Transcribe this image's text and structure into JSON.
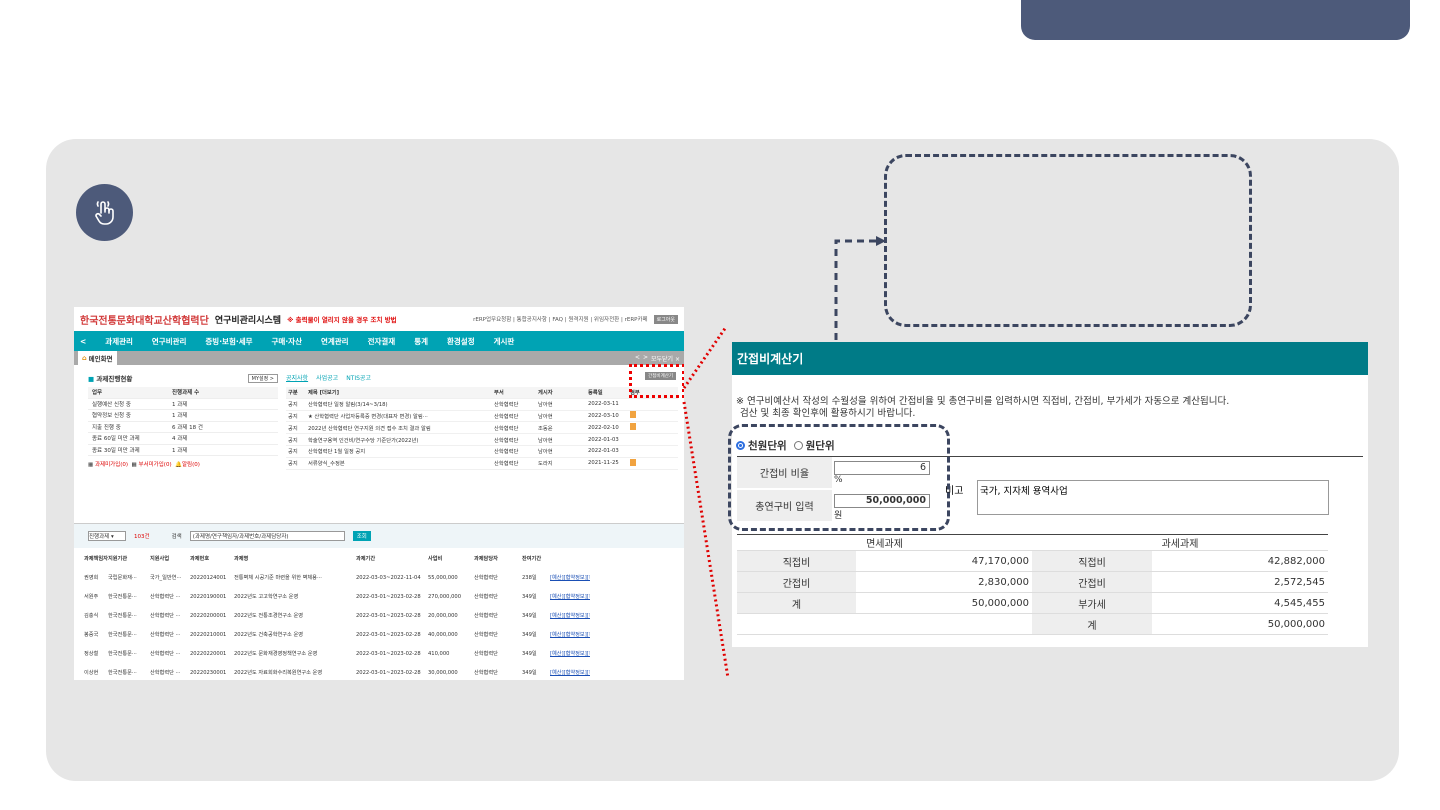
{
  "erp": {
    "logo": "한국전통문화대학교산학협력단",
    "system_name": "연구비관리시스템",
    "notice": "※ 출력물이 열리지 않을 경우 조치 방법",
    "top_links": "rERP업무요청함 | 통합공지사항 | FAQ | 원격지원 | 위임자전환 | rERP카페",
    "logout": "로그아웃",
    "nav": [
      "과제관리",
      "연구비관리",
      "증빙·보험·세무",
      "구매·자산",
      "연계관리",
      "전자결재",
      "통계",
      "환경설정",
      "게시판"
    ],
    "home_tab": "메인화면",
    "tab_ctrl": [
      "<",
      ">",
      "모두닫기 ×"
    ],
    "status": {
      "title": "과제진행현황",
      "my_button": "MY설정 >",
      "headers": [
        "업무",
        "진행과제 수"
      ],
      "rows": [
        [
          "실행예산 신청 중",
          "1 과제"
        ],
        [
          "협약정보 신청 중",
          "1 과제"
        ],
        [
          "지출 진행 중",
          "6 과제 18 건"
        ],
        [
          "종료 60일 미만 과제",
          "4 과제"
        ],
        [
          "종료 30일 미만 과제",
          "1 과제"
        ]
      ],
      "footer": [
        "과제미가입(0)",
        "부서미가입(0)",
        "알림(0)"
      ]
    },
    "notices": {
      "tabs": [
        "공지사항",
        "사업공고",
        "NTIS공고"
      ],
      "calc_button": "간접비계산기",
      "headers": [
        "구분",
        "제목 [더보기]",
        "부서",
        "게시자",
        "등록일",
        "첨부"
      ],
      "rows": [
        [
          "공지",
          "산학협력단 일정 알림(3/14~3/18)",
          "산학협력단",
          "남아현",
          "2022-03-11",
          ""
        ],
        [
          "공지",
          "★ 산학협력단 사업자등록증 변경(대표자 변경) 알림···",
          "산학협력단",
          "남아현",
          "2022-03-10",
          "file"
        ],
        [
          "공지",
          "2022년 산학협력단 연구지원 의견 접수 조치 결과 알림",
          "산학협력단",
          "조동윤",
          "2022-02-10",
          "file"
        ],
        [
          "공지",
          "학술연구용역 인건비/연구수당 기준단가(2022년)",
          "산학협력단",
          "남아현",
          "2022-01-03",
          ""
        ],
        [
          "공지",
          "산학협력단 1월 일정 공지",
          "산학협력단",
          "남아현",
          "2022-01-03",
          ""
        ],
        [
          "공지",
          "서류양식_수정본",
          "산학협력단",
          "도라지",
          "2021-11-25",
          "file"
        ]
      ]
    },
    "list": {
      "select": "진행과제",
      "count": "103건",
      "search_label": "검색",
      "search_placeholder": "(과제명/연구책임자/과제번호/과제담당자)",
      "search_button": "조회",
      "headers": [
        "과제책임자",
        "지원기관",
        "지원사업",
        "과제번호",
        "과제명",
        "과제기간",
        "사업비",
        "과제담당자",
        "잔여기간",
        ""
      ],
      "rows": [
        [
          "권영희",
          "국립문화재···",
          "국가_일반연···",
          "20220124001",
          "전통벽체 시공기준 마련을 위한 벽체용···",
          "2022-03-03~2022-11-04",
          "55,000,000",
          "산학협력단",
          "238일",
          "[예산][협약정보][청구][기금]"
        ],
        [
          "서원주",
          "한국전통문···",
          "산학협력단 ···",
          "20220190001",
          "2022년도 고고학연구소 운영",
          "2022-03-01~2023-02-28",
          "270,000,000",
          "산학협력단",
          "349일",
          "[예산][협약정보][청구][기금]"
        ],
        [
          "김충식",
          "한국전통문···",
          "산학협력단 ···",
          "20220200001",
          "2022년도 전통조경연구소 운영",
          "2022-03-01~2023-02-28",
          "20,000,000",
          "산학협력단",
          "349일",
          "[예산][협약정보][청구][기금]"
        ],
        [
          "봉중국",
          "한국전통문···",
          "산학협력단 ···",
          "20220210001",
          "2022년도 건축공학연구소 운영",
          "2022-03-01~2023-02-28",
          "40,000,000",
          "산학협력단",
          "349일",
          "[예산][협약정보][청구][기금]"
        ],
        [
          "정상철",
          "한국전통문···",
          "산학협력단 ···",
          "20220220001",
          "2022년도 문화재경영정책연구소 운영",
          "2022-03-01~2023-02-28",
          "410,000",
          "산학협력단",
          "349일",
          "[예산][협약정보][청구][기금]"
        ],
        [
          "이상현",
          "한국전통문···",
          "산학협력단 ···",
          "20220230001",
          "2022년도 자료회화수리복원연구소 운영",
          "2022-03-01~2023-02-28",
          "30,000,000",
          "산학협력단",
          "349일",
          "[예산][협약정보][청구][기금]"
        ]
      ]
    }
  },
  "calculator": {
    "title": "간접비계산기",
    "note_line1": "※ 연구비예산서 작성의 수월성을 위하여 간접비율 및 총연구비를 입력하시면 직접비, 간접비, 부가세가 자동으로 계산됩니다.",
    "note_line2": "검산 및 최종 확인후에 활용하시기 바랍니다.",
    "unit_options": [
      "천원단위",
      "원단위"
    ],
    "inputs": {
      "rate_label": "간접비 비율",
      "rate_value": "6",
      "rate_unit": "%",
      "total_label": "총연구비 입력",
      "total_value": "50,000,000",
      "total_unit": "원"
    },
    "remark_label": "비고",
    "remark_value": "국가, 지자체 용역사업",
    "result": {
      "exempt_header": "면세과제",
      "taxable_header": "과세과제",
      "rows": [
        {
          "l1": "직접비",
          "v1": "47,170,000",
          "l2": "직접비",
          "v2": "42,882,000"
        },
        {
          "l1": "간접비",
          "v1": "2,830,000",
          "l2": "간접비",
          "v2": "2,572,545"
        },
        {
          "l1": "계",
          "v1": "50,000,000",
          "l2": "부가세",
          "v2": "4,545,455"
        },
        {
          "l1": "",
          "v1": "",
          "l2": "계",
          "v2": "50,000,000"
        }
      ]
    }
  },
  "colors": {
    "accent": "#4d5a7a",
    "erp_nav": "#00a3b4",
    "calc_header": "#007b87",
    "highlight_red": "#e00000"
  },
  "icons": [
    "hand-pointer-icon"
  ]
}
